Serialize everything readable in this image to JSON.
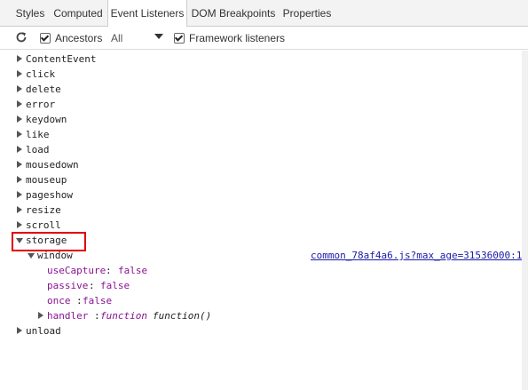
{
  "tabs": [
    {
      "label": "Styles"
    },
    {
      "label": "Computed"
    },
    {
      "label": "Event Listeners"
    },
    {
      "label": "DOM Breakpoints"
    },
    {
      "label": "Properties"
    }
  ],
  "toolbar": {
    "refresh_icon": "refresh-icon",
    "ancestors_label": "Ancestors",
    "ancestors_checked": true,
    "filter_value": "All",
    "framework_label": "Framework listeners",
    "framework_checked": true
  },
  "events": [
    {
      "name": "ContentEvent"
    },
    {
      "name": "click"
    },
    {
      "name": "delete"
    },
    {
      "name": "error"
    },
    {
      "name": "keydown"
    },
    {
      "name": "like"
    },
    {
      "name": "load"
    },
    {
      "name": "mousedown"
    },
    {
      "name": "mouseup"
    },
    {
      "name": "pageshow"
    },
    {
      "name": "resize"
    },
    {
      "name": "scroll"
    },
    {
      "name": "storage",
      "expanded": true
    },
    {
      "name": "unload"
    }
  ],
  "storage_listener": {
    "target": "window",
    "source_link": "common_78af4a6.js?max_age=31536000:1",
    "props": [
      {
        "key": "useCapture",
        "value": "false"
      },
      {
        "key": "passive",
        "value": "false"
      },
      {
        "key": "once",
        "value": "false"
      }
    ],
    "handler_key": "handler",
    "handler_kw": "function",
    "handler_value": "function()"
  },
  "colors": {
    "highlight": "#e00000",
    "link": "#1a1aa6",
    "prop": "#881391"
  }
}
